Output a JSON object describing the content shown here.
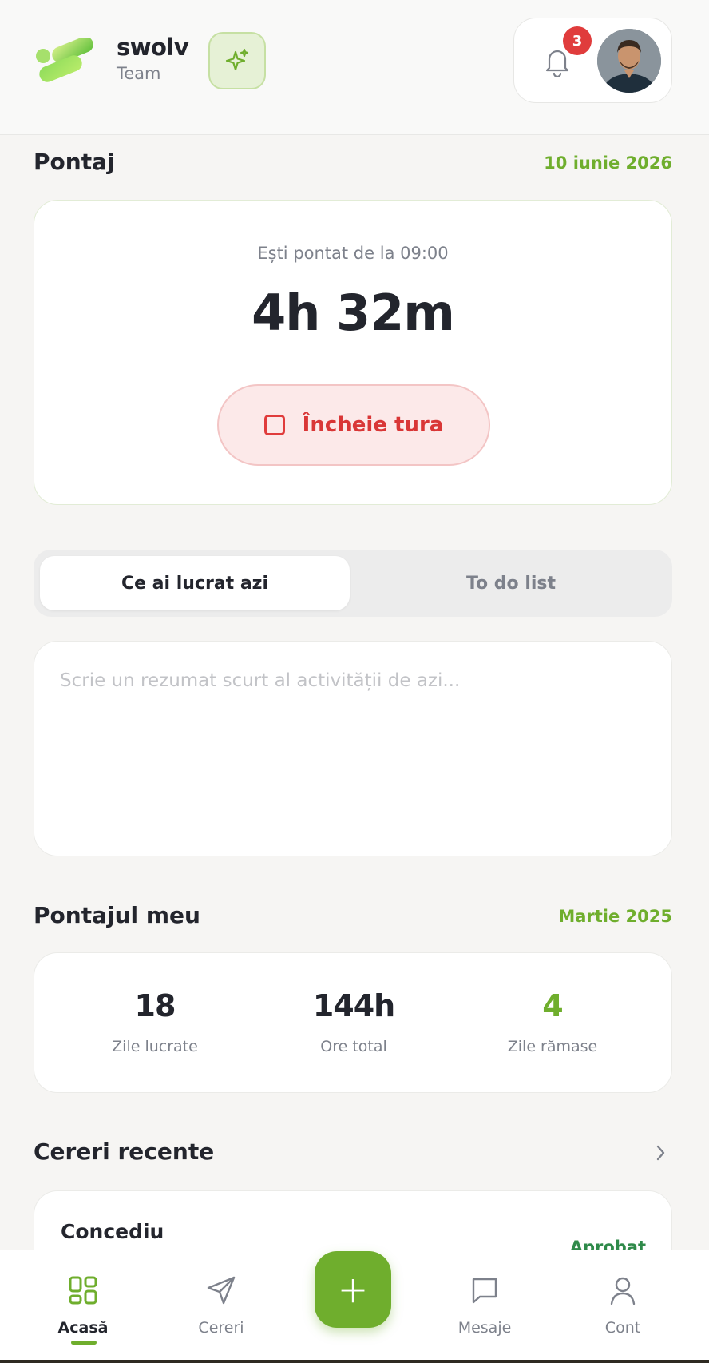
{
  "header": {
    "brand_name": "swolv",
    "brand_sub": "Team",
    "notification_count": "3",
    "icons": {
      "logo": "swolv-logo",
      "ai": "sparkle-icon",
      "bell": "bell-icon",
      "avatar": "user-avatar"
    }
  },
  "clock": {
    "section_title": "Pontaj",
    "date": "10 iunie 2026",
    "subtitle": "Ești pontat de la 09:00",
    "elapsed": "4h 32m",
    "end_shift_label": "Încheie tura"
  },
  "tabs": {
    "active": "Ce ai lucrat azi",
    "inactive": "To do list"
  },
  "note": {
    "placeholder": "Scrie un rezumat scurt al activității de azi...",
    "value": ""
  },
  "stats": {
    "section_title": "Pontajul meu",
    "period": "Martie 2025",
    "items": [
      {
        "value": "18",
        "label": "Zile lucrate"
      },
      {
        "value": "144h",
        "label": "Ore total"
      },
      {
        "value": "4",
        "label": "Zile rămase"
      }
    ]
  },
  "requests": {
    "section_title": "Cereri recente",
    "items": [
      {
        "title": "Concediu",
        "status": "Aprobat"
      }
    ]
  },
  "nav": {
    "items": [
      {
        "label": "Acasă",
        "icon": "grid-icon"
      },
      {
        "label": "Cereri",
        "icon": "send-icon"
      },
      {
        "label": "Mesaje",
        "icon": "message-icon"
      },
      {
        "label": "Cont",
        "icon": "user-icon"
      }
    ],
    "fab_icon": "plus-icon"
  },
  "colors": {
    "accent": "#6fae2d",
    "danger": "#e03c3c",
    "approved": "#2f8a4a"
  }
}
